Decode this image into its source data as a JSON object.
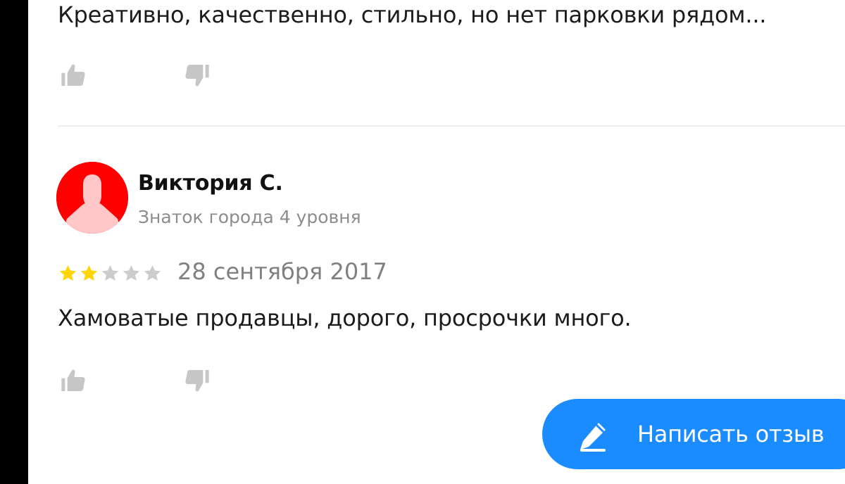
{
  "reviews": [
    {
      "text": "Креативно, качественно, стильно, но нет парковки рядом...",
      "actions": {
        "like_icon": "thumbs-up-icon",
        "dislike_icon": "thumbs-down-icon"
      }
    },
    {
      "author": {
        "name": "Виктория С.",
        "level": "Знаток города 4 уровня",
        "avatar_color": "#ff0000",
        "avatar_icon": "person-silhouette-icon"
      },
      "rating": {
        "value": 2,
        "max": 5,
        "filled_color": "#ffd600",
        "empty_color": "#cccccc"
      },
      "date": "28 сентября 2017",
      "text": "Хамоватые продавцы, дорого, просрочки много.",
      "actions": {
        "like_icon": "thumbs-up-icon",
        "dislike_icon": "thumbs-down-icon"
      }
    }
  ],
  "write_review_button": {
    "label": "Написать отзыв",
    "icon": "pencil-icon",
    "color": "#1a8cff"
  }
}
